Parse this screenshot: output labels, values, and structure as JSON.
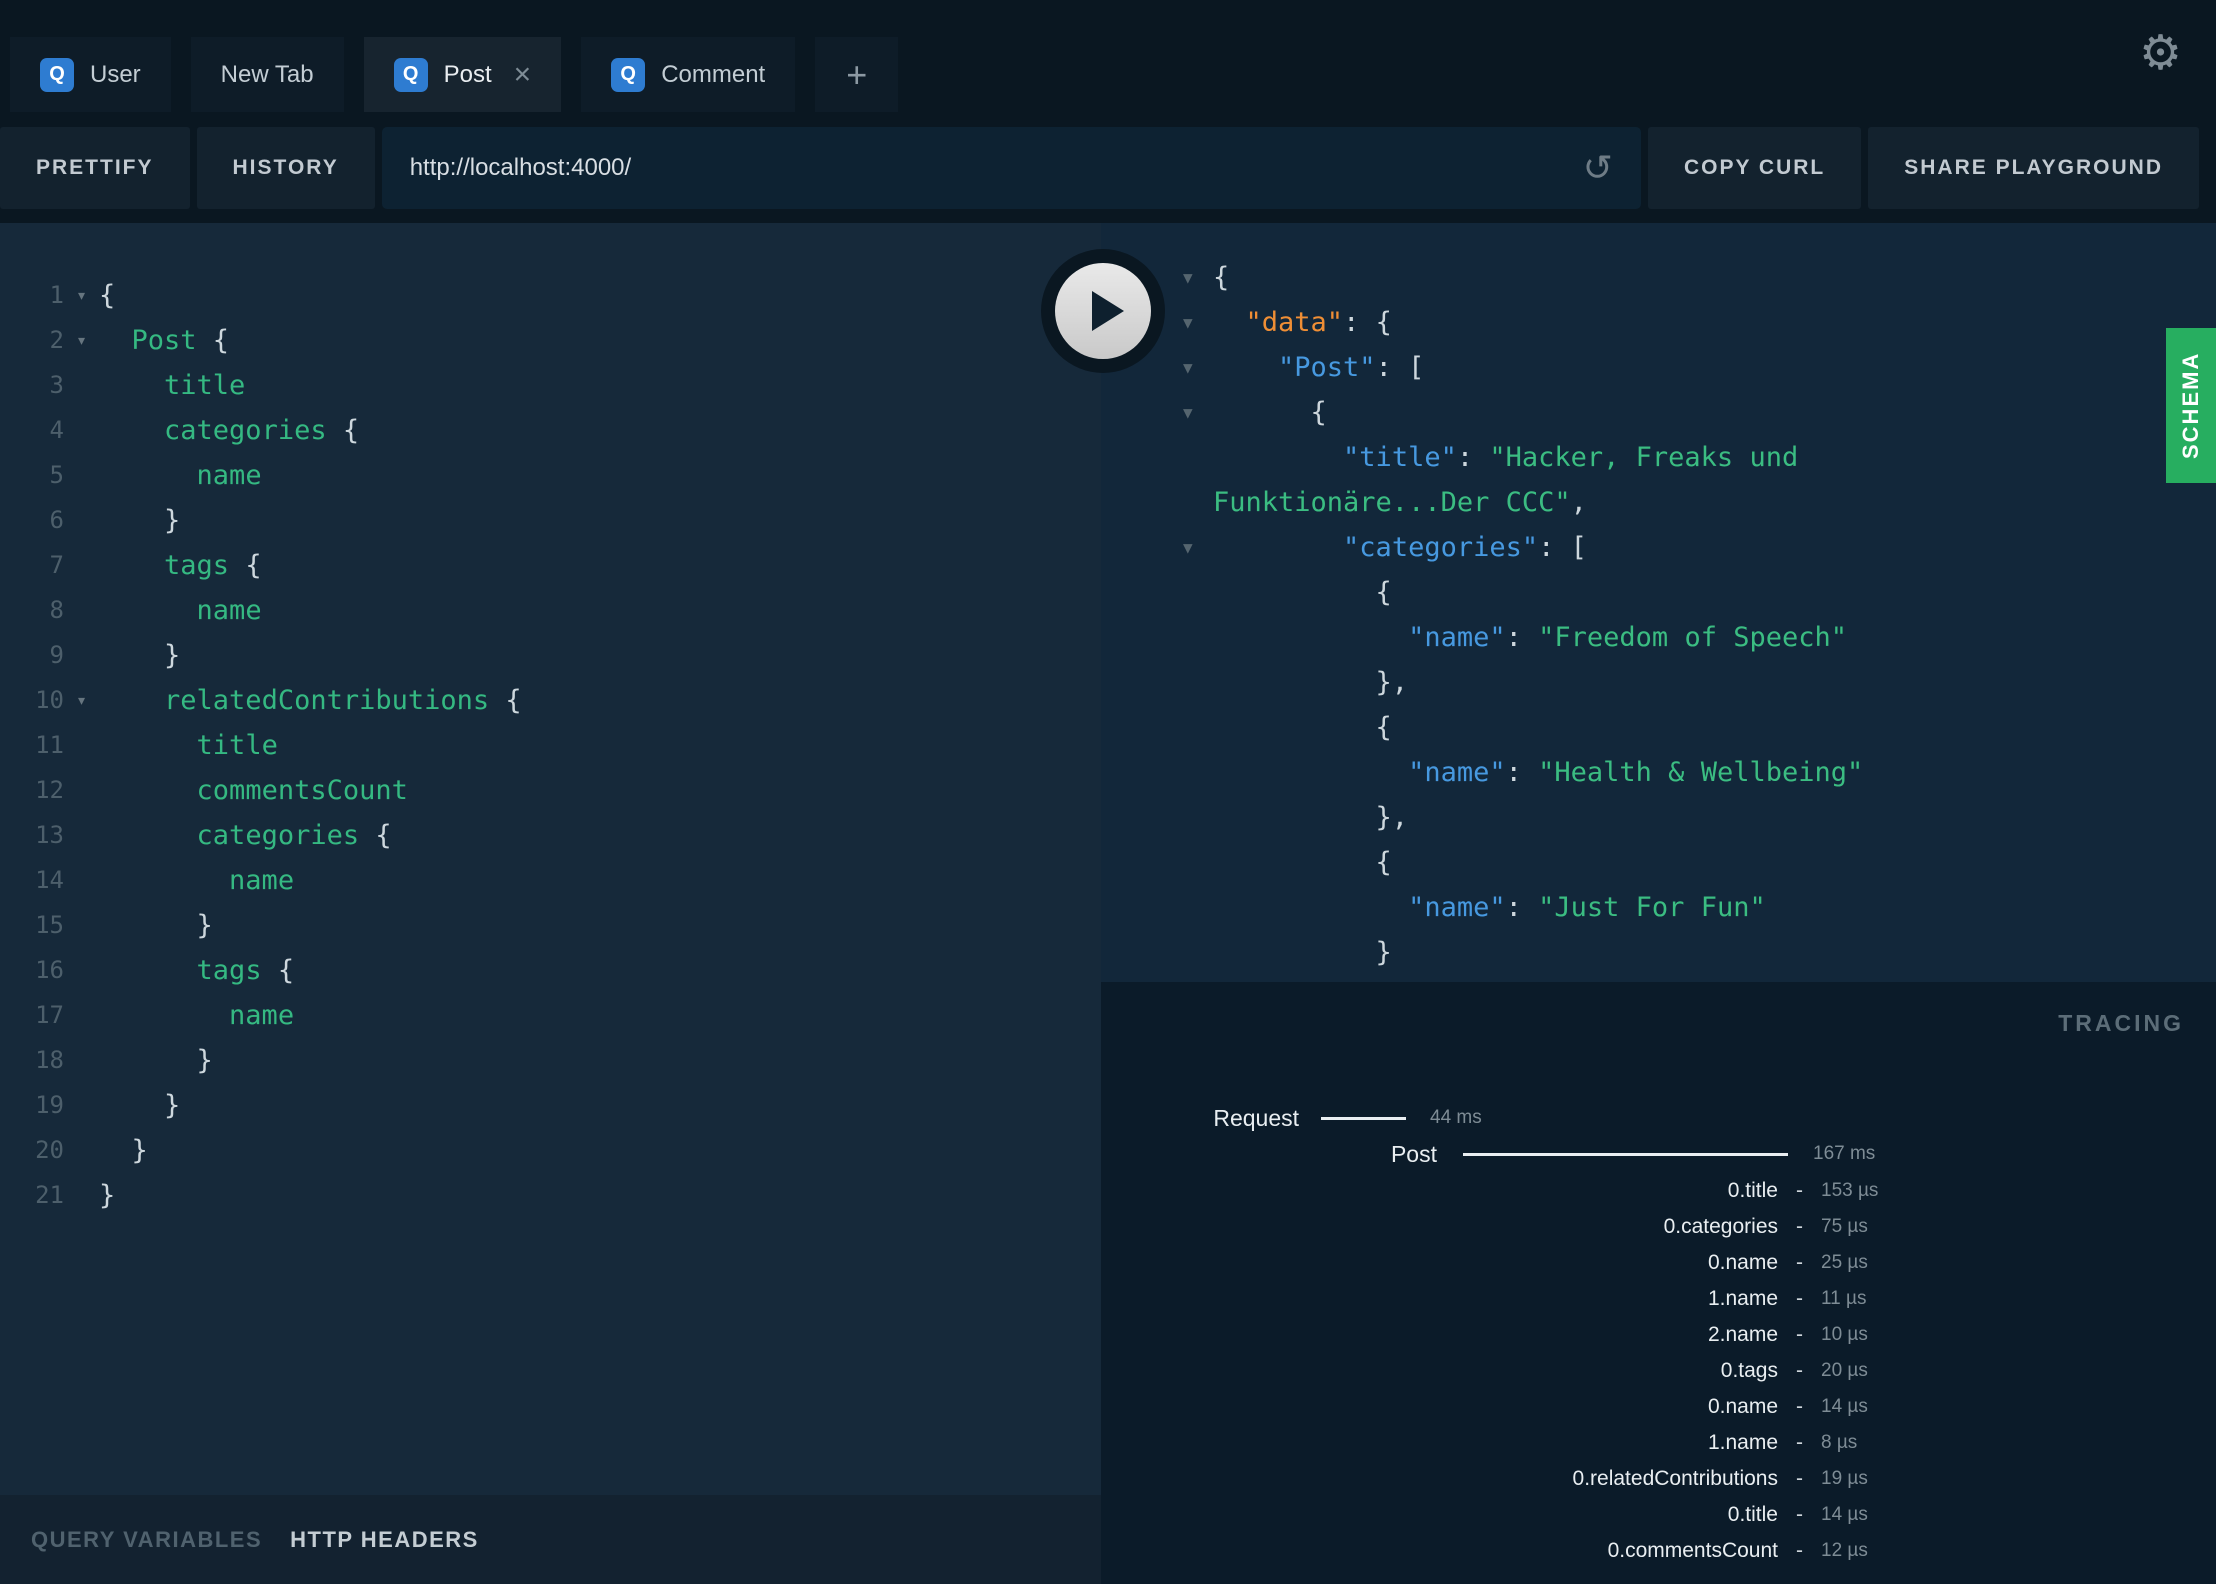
{
  "tabs": {
    "query_badge": "Q",
    "add_label": "+",
    "close_label": "×",
    "items": [
      {
        "label": "User",
        "icon": true,
        "active": false,
        "closable": false
      },
      {
        "label": "New Tab",
        "icon": false,
        "active": false,
        "closable": false
      },
      {
        "label": "Post",
        "icon": true,
        "active": true,
        "closable": true
      },
      {
        "label": "Comment",
        "icon": true,
        "active": false,
        "closable": false
      }
    ]
  },
  "settings_icon": "⚙",
  "toolbar": {
    "prettify": "PRETTIFY",
    "history": "HISTORY",
    "url": "http://localhost:4000/",
    "reload_icon": "↺",
    "copy_curl": "COPY CURL",
    "share": "SHARE PLAYGROUND"
  },
  "editor": {
    "fold_icon": "▾",
    "lines": [
      {
        "n": 1,
        "fold": true,
        "seg": [
          [
            "p",
            "{"
          ]
        ]
      },
      {
        "n": 2,
        "fold": true,
        "seg": [
          [
            "p",
            "  "
          ],
          [
            "f",
            "Post"
          ],
          [
            "p",
            " {"
          ]
        ]
      },
      {
        "n": 3,
        "seg": [
          [
            "p",
            "    "
          ],
          [
            "f",
            "title"
          ]
        ]
      },
      {
        "n": 4,
        "seg": [
          [
            "p",
            "    "
          ],
          [
            "f",
            "categories"
          ],
          [
            "p",
            " {"
          ]
        ]
      },
      {
        "n": 5,
        "seg": [
          [
            "p",
            "      "
          ],
          [
            "f",
            "name"
          ]
        ]
      },
      {
        "n": 6,
        "seg": [
          [
            "p",
            "    }"
          ]
        ]
      },
      {
        "n": 7,
        "seg": [
          [
            "p",
            "    "
          ],
          [
            "f",
            "tags"
          ],
          [
            "p",
            " {"
          ]
        ]
      },
      {
        "n": 8,
        "seg": [
          [
            "p",
            "      "
          ],
          [
            "f",
            "name"
          ]
        ]
      },
      {
        "n": 9,
        "seg": [
          [
            "p",
            "    }"
          ]
        ]
      },
      {
        "n": 10,
        "fold": true,
        "seg": [
          [
            "p",
            "    "
          ],
          [
            "f",
            "relatedContributions"
          ],
          [
            "p",
            " {"
          ]
        ]
      },
      {
        "n": 11,
        "seg": [
          [
            "p",
            "      "
          ],
          [
            "f",
            "title"
          ]
        ]
      },
      {
        "n": 12,
        "seg": [
          [
            "p",
            "      "
          ],
          [
            "f",
            "commentsCount"
          ]
        ]
      },
      {
        "n": 13,
        "seg": [
          [
            "p",
            "      "
          ],
          [
            "f",
            "categories"
          ],
          [
            "p",
            " {"
          ]
        ]
      },
      {
        "n": 14,
        "seg": [
          [
            "p",
            "        "
          ],
          [
            "f",
            "name"
          ]
        ]
      },
      {
        "n": 15,
        "seg": [
          [
            "p",
            "      }"
          ]
        ]
      },
      {
        "n": 16,
        "seg": [
          [
            "p",
            "      "
          ],
          [
            "f",
            "tags"
          ],
          [
            "p",
            " {"
          ]
        ]
      },
      {
        "n": 17,
        "seg": [
          [
            "p",
            "        "
          ],
          [
            "f",
            "name"
          ]
        ]
      },
      {
        "n": 18,
        "seg": [
          [
            "p",
            "      }"
          ]
        ]
      },
      {
        "n": 19,
        "seg": [
          [
            "p",
            "    }"
          ]
        ]
      },
      {
        "n": 20,
        "seg": [
          [
            "p",
            "  }"
          ]
        ]
      },
      {
        "n": 21,
        "seg": [
          [
            "p",
            "}"
          ]
        ]
      }
    ]
  },
  "response": {
    "collapse_icon": "▼",
    "lines": [
      {
        "arrow": true,
        "seg": [
          [
            "p",
            "{"
          ]
        ]
      },
      {
        "arrow": true,
        "seg": [
          [
            "p",
            "  "
          ],
          [
            "ko",
            "\"data\""
          ],
          [
            "p",
            ": {"
          ]
        ]
      },
      {
        "arrow": true,
        "seg": [
          [
            "p",
            "    "
          ],
          [
            "k",
            "\"Post\""
          ],
          [
            "p",
            ": ["
          ]
        ]
      },
      {
        "arrow": true,
        "seg": [
          [
            "p",
            "      {"
          ]
        ]
      },
      {
        "arrow": false,
        "seg": [
          [
            "p",
            "        "
          ],
          [
            "k",
            "\"title\""
          ],
          [
            "p",
            ": "
          ],
          [
            "s",
            "\"Hacker, Freaks und"
          ]
        ]
      },
      {
        "arrow": false,
        "seg": [
          [
            "s",
            "Funktionäre...Der CCC\""
          ],
          [
            "p",
            ","
          ]
        ]
      },
      {
        "arrow": true,
        "seg": [
          [
            "p",
            "        "
          ],
          [
            "k",
            "\"categories\""
          ],
          [
            "p",
            ": ["
          ]
        ]
      },
      {
        "arrow": false,
        "seg": [
          [
            "p",
            "          {"
          ]
        ]
      },
      {
        "arrow": false,
        "seg": [
          [
            "p",
            "            "
          ],
          [
            "k",
            "\"name\""
          ],
          [
            "p",
            ": "
          ],
          [
            "s",
            "\"Freedom of Speech\""
          ]
        ]
      },
      {
        "arrow": false,
        "seg": [
          [
            "p",
            "          },"
          ]
        ]
      },
      {
        "arrow": false,
        "seg": [
          [
            "p",
            "          {"
          ]
        ]
      },
      {
        "arrow": false,
        "seg": [
          [
            "p",
            "            "
          ],
          [
            "k",
            "\"name\""
          ],
          [
            "p",
            ": "
          ],
          [
            "s",
            "\"Health & Wellbeing\""
          ]
        ]
      },
      {
        "arrow": false,
        "seg": [
          [
            "p",
            "          },"
          ]
        ]
      },
      {
        "arrow": false,
        "seg": [
          [
            "p",
            "          {"
          ]
        ]
      },
      {
        "arrow": false,
        "seg": [
          [
            "p",
            "            "
          ],
          [
            "k",
            "\"name\""
          ],
          [
            "p",
            ": "
          ],
          [
            "s",
            "\"Just For Fun\""
          ]
        ]
      },
      {
        "arrow": false,
        "seg": [
          [
            "p",
            "          }"
          ]
        ]
      },
      {
        "arrow": false,
        "seg": [
          [
            "p",
            "        ]"
          ]
        ]
      }
    ]
  },
  "tracing": {
    "title": "TRACING",
    "dash": "-",
    "bars": [
      {
        "label": "Request",
        "duration": "44 ms"
      },
      {
        "label": "Post",
        "duration": "167 ms"
      }
    ],
    "rows": [
      {
        "label": "0.title",
        "duration": "153 µs"
      },
      {
        "label": "0.categories",
        "duration": "75 µs"
      },
      {
        "label": "0.name",
        "duration": "25 µs"
      },
      {
        "label": "1.name",
        "duration": "11 µs"
      },
      {
        "label": "2.name",
        "duration": "10 µs"
      },
      {
        "label": "0.tags",
        "duration": "20 µs"
      },
      {
        "label": "0.name",
        "duration": "14 µs"
      },
      {
        "label": "1.name",
        "duration": "8 µs"
      },
      {
        "label": "0.relatedContributions",
        "duration": "19 µs"
      },
      {
        "label": "0.title",
        "duration": "14 µs"
      },
      {
        "label": "0.commentsCount",
        "duration": "12 µs"
      }
    ]
  },
  "footer": {
    "query_variables": "QUERY VARIABLES",
    "http_headers": "HTTP HEADERS"
  },
  "schema_tab": {
    "label": "SCHEMA"
  },
  "colors": {
    "schema_green": "#27ae60",
    "badge_blue": "#2e7cd1",
    "field_green": "#35b982",
    "key_blue": "#4799e0",
    "data_key_orange": "#ef8e35",
    "string_green": "#3bbd82"
  }
}
